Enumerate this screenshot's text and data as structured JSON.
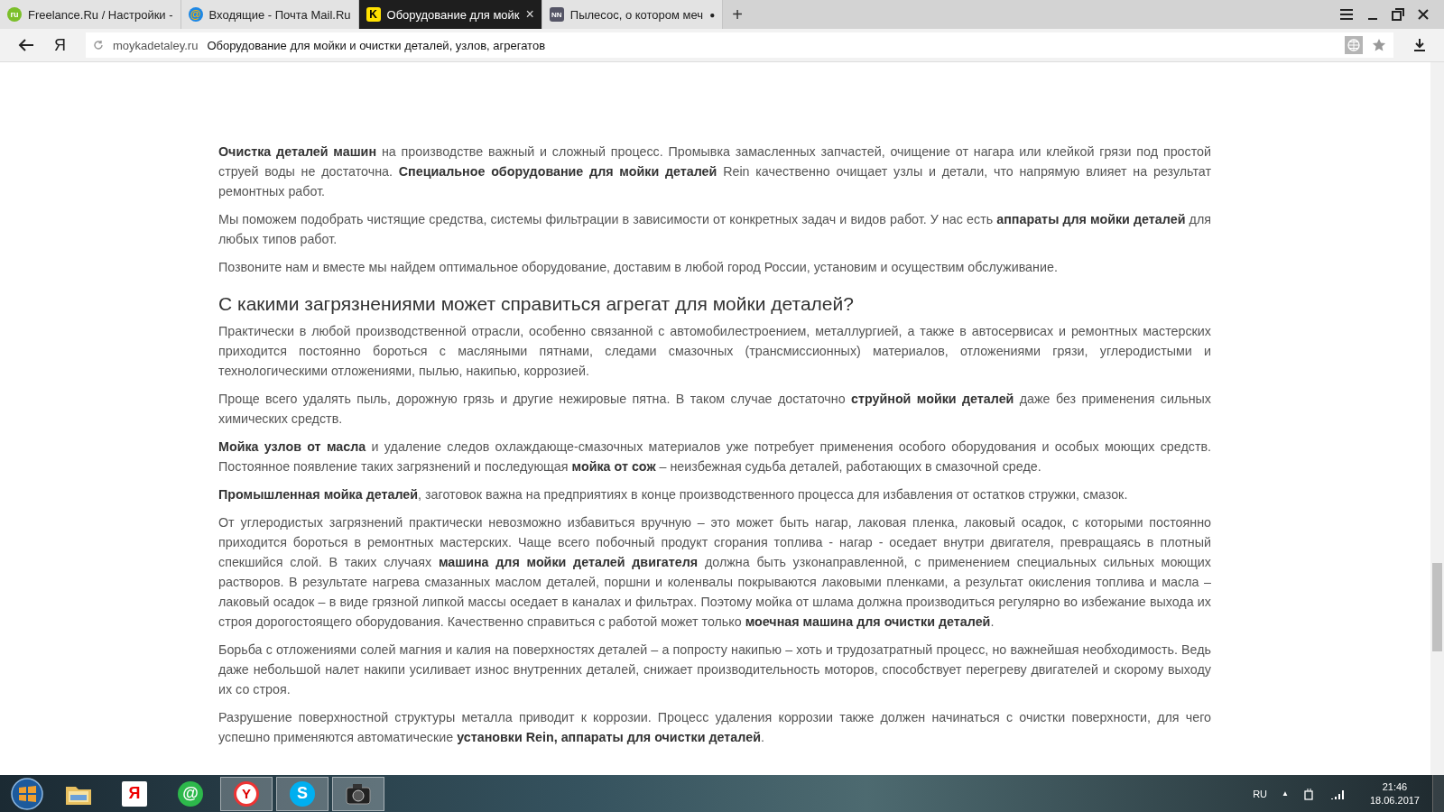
{
  "tabs": [
    {
      "badge": "ru",
      "kind": "green",
      "title": "Freelance.Ru / Настройки -",
      "selected": false
    },
    {
      "badge": "@",
      "kind": "mail",
      "title": "Входящие - Почта Mail.Ru",
      "selected": false
    },
    {
      "badge": "K",
      "kind": "yellow",
      "title": "Оборудование для мойк",
      "indicator": "×",
      "selected": true
    },
    {
      "badge": "NN",
      "kind": "nn",
      "title": "Пылесос, о котором меч",
      "indicator": "●",
      "selected": false
    }
  ],
  "new_tab": "+",
  "address_bar": {
    "logo": "Я",
    "domain": "moykadetaley.ru",
    "page_title": "Оборудование для мойки и очистки деталей, узлов, агрегатов"
  },
  "article": [
    {
      "kind": "p",
      "text": "**Очистка деталей машин** на производстве важный и сложный процесс. Промывка замасленных запчастей, очищение от нагара или клейкой грязи под простой струей воды не достаточна. **Специальное оборудование для мойки деталей** Rein качественно очищает узлы и детали, что напрямую влияет на результат ремонтных работ."
    },
    {
      "kind": "p",
      "text": "Мы поможем подобрать чистящие средства, системы фильтрации в зависимости от конкретных задач и видов работ. У нас есть **аппараты для мойки деталей** для любых типов работ."
    },
    {
      "kind": "p",
      "text": "Позвоните нам и вместе мы найдем оптимальное оборудование, доставим в  любой город России, установим и осуществим обслуживание."
    },
    {
      "kind": "h2",
      "text": "С какими загрязнениями может справиться агрегат для мойки деталей?"
    },
    {
      "kind": "p",
      "text": "Практически в любой производственной отрасли, особенно связанной с автомобилестроением, металлургией, а также в автосервисах и ремонтных мастерских приходится постоянно бороться с масляными пятнами, следами смазочных (трансмиссионных) материалов, отложениями грязи, углеродистыми и технологическими отложениями, пылью, накипью, коррозией."
    },
    {
      "kind": "p",
      "text": "Проще всего удалять пыль, дорожную грязь и другие нежировые пятна. В таком случае достаточно **струйной мойки деталей** даже без применения сильных химических средств."
    },
    {
      "kind": "p",
      "text": "**Мойка узлов от масла** и удаление следов охлаждающе-смазочных материалов уже потребует применения особого оборудования и особых моющих средств. Постоянное появление таких загрязнений и последующая **мойка от сож** – неизбежная судьба деталей, работающих в смазочной среде."
    },
    {
      "kind": "p",
      "text": "**Промышленная мойка деталей**, заготовок важна на предприятиях в конце производственного процесса для избавления от остатков стружки, смазок."
    },
    {
      "kind": "p",
      "text": "От углеродистых загрязнений практически невозможно избавиться вручную – это может быть нагар, лаковая пленка, лаковый осадок, с которыми постоянно приходится бороться в ремонтных мастерских. Чаще всего побочный продукт сгорания топлива - нагар - оседает внутри двигателя, превращаясь в плотный спекшийся слой. В таких случаях **машина для мойки деталей двигателя** должна быть узконаправленной, с применением специальных сильных моющих растворов. В результате нагрева смазанных маслом деталей, поршни и коленвалы покрываются лаковыми пленками, а результат окисления топлива и масла – лаковый осадок – в виде грязной липкой массы оседает в каналах и фильтрах. Поэтому мойка от шлама должна производиться регулярно во избежание выхода их строя дорогостоящего оборудования. Качественно справиться с работой может только **моечная машина для очистки деталей**."
    },
    {
      "kind": "p",
      "text": "Борьба с отложениями солей магния и калия на поверхностях деталей – а попросту накипью – хоть и трудозатратный процесс, но важнейшая необходимость. Ведь даже небольшой налет накипи усиливает износ внутренних деталей, снижает производительность моторов, способствует перегреву двигателей и скорому выходу их со строя."
    },
    {
      "kind": "p",
      "text": "Разрушение поверхностной структуры металла приводит к коррозии. Процесс удаления коррозии также должен начинаться с очистки поверхности, для чего успешно применяются  автоматические **установки Rein, аппараты для очистки деталей**."
    }
  ],
  "taskbar": {
    "apps": [
      {
        "kind": "folder",
        "active": false
      },
      {
        "kind": "yandex",
        "glyph": "Я",
        "active": false
      },
      {
        "kind": "mail",
        "glyph": "@",
        "active": false
      },
      {
        "kind": "ybrowser",
        "glyph": "Y",
        "active": true
      },
      {
        "kind": "skype",
        "glyph": "S",
        "active": true
      },
      {
        "kind": "camera",
        "active": true
      }
    ],
    "language": "RU",
    "tray_arrow": "▲",
    "time": "21:46",
    "date": "18.06.2017"
  }
}
